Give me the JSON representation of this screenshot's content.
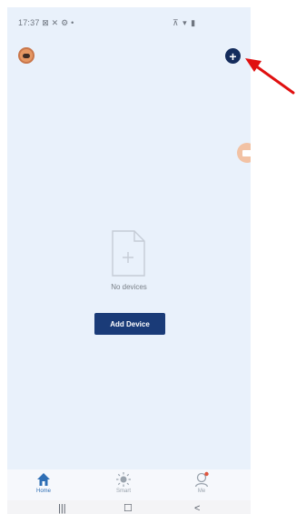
{
  "status_bar": {
    "time": "17:37",
    "left_icons": "⊠ ✕ ⚙ •",
    "right_icons": "⊼ ▾ ▮"
  },
  "header": {
    "avatar_icon": "robot-avatar-icon",
    "add_icon": "plus-circle-icon"
  },
  "floating": {
    "icon": "camera-icon"
  },
  "empty_state": {
    "icon": "blank-document-plus-icon",
    "message": "No devices",
    "button_label": "Add Device"
  },
  "bottom_nav": [
    {
      "label": "Home",
      "icon": "house-icon",
      "active": true
    },
    {
      "label": "Smart",
      "icon": "sun-icon",
      "active": false
    },
    {
      "label": "Me",
      "icon": "person-icon",
      "active": false
    }
  ],
  "system_nav": {
    "recent": "|||",
    "home": "☐",
    "back": "<"
  },
  "colors": {
    "background": "#e9f1fb",
    "primary": "#1a3b78",
    "accent_orange": "#e59763",
    "annotation_arrow": "#e01010"
  }
}
